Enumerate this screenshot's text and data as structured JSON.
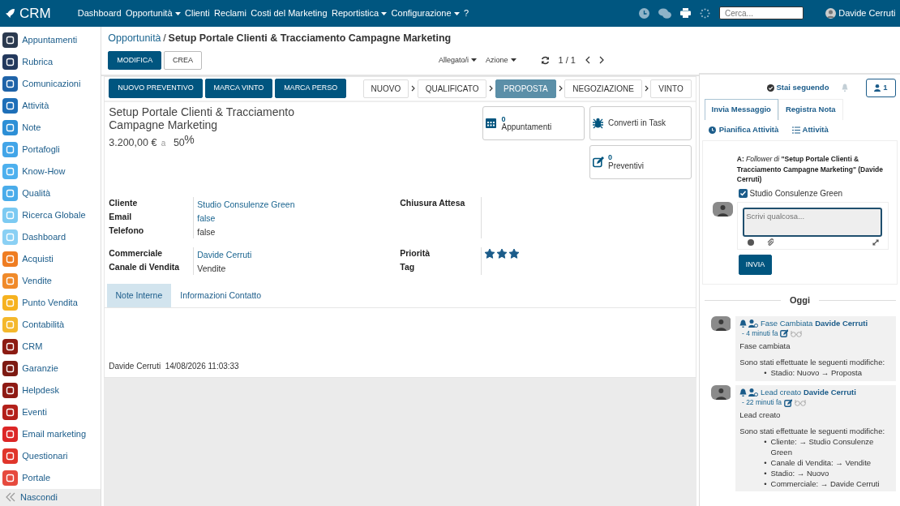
{
  "navbar": {
    "brand": "CRM",
    "menu": [
      {
        "label": "Dashboard",
        "dropdown": false
      },
      {
        "label": "Opportunità",
        "dropdown": true
      },
      {
        "label": "Clienti",
        "dropdown": false
      },
      {
        "label": "Reclami",
        "dropdown": false
      },
      {
        "label": "Costi del Marketing",
        "dropdown": false
      },
      {
        "label": "Reportistica",
        "dropdown": true
      },
      {
        "label": "Configurazione",
        "dropdown": true
      },
      {
        "label": "?",
        "dropdown": false
      }
    ],
    "search": {
      "placeholder": "Cerca..."
    },
    "user": "Davide Cerruti"
  },
  "sidebar": {
    "items": [
      {
        "label": "Appuntamenti",
        "color": "#2b3a4f"
      },
      {
        "label": "Rubrica",
        "color": "#23395d"
      },
      {
        "label": "Comunicazioni",
        "color": "#1f63a8"
      },
      {
        "label": "Attività",
        "color": "#1e6fb8"
      },
      {
        "label": "Note",
        "color": "#2d8fd6"
      },
      {
        "label": "Portafogli",
        "color": "#42a5e8"
      },
      {
        "label": "Know-How",
        "color": "#4db0ee"
      },
      {
        "label": "Qualità",
        "color": "#4aacea"
      },
      {
        "label": "Ricerca Globale",
        "color": "#7ccaf2"
      },
      {
        "label": "Dashboard",
        "color": "#8ad0f4"
      },
      {
        "label": "Acquisti",
        "color": "#ef7d22"
      },
      {
        "label": "Vendite",
        "color": "#f08a2a"
      },
      {
        "label": "Punto Vendita",
        "color": "#f6b21f"
      },
      {
        "label": "Contabilità",
        "color": "#f4b82c"
      },
      {
        "label": "CRM",
        "color": "#8c1c13"
      },
      {
        "label": "Garanzie",
        "color": "#7d1a12"
      },
      {
        "label": "Helpdesk",
        "color": "#8e1a14"
      },
      {
        "label": "Eventi",
        "color": "#b3201b"
      },
      {
        "label": "Email marketing",
        "color": "#dc2626"
      },
      {
        "label": "Questionari",
        "color": "#e0352b"
      },
      {
        "label": "Portale",
        "color": "#e64a3e"
      }
    ],
    "hide": "Nascondi"
  },
  "breadcrumb": {
    "parent": "Opportunità",
    "separator": "/",
    "current": "Setup Portale Clienti & Tracciamento Campagne Marketing"
  },
  "toolbar": {
    "edit": "MODIFICA",
    "create": "CREA",
    "dropdowns": [
      "Allegato/i",
      "Azione"
    ],
    "pager": "1 / 1"
  },
  "actions": [
    "NUOVO PREVENTIVO",
    "MARCA VINTO",
    "MARCA PERSO"
  ],
  "stages": [
    {
      "label": "NUOVO",
      "selected": false
    },
    {
      "label": "QUALIFICATO",
      "selected": false
    },
    {
      "label": "PROPOSTA",
      "selected": true
    },
    {
      "label": "NEGOZIAZIONE",
      "selected": false
    },
    {
      "label": "VINTO",
      "selected": false
    }
  ],
  "record": {
    "title": "Setup Portale Clienti & Tracciamento Campagne Marketing",
    "amount": "3.200,00 €",
    "at": "a",
    "probability": "50",
    "percent": "%"
  },
  "smart_buttons": [
    {
      "kind": "calendar",
      "count": "0",
      "label": "Appuntamenti"
    },
    {
      "kind": "bug",
      "label": "Converti in Task"
    },
    {
      "kind": "edit",
      "count": "0",
      "label": "Preventivi"
    }
  ],
  "field_groups": [
    {
      "left": [
        {
          "label": "Cliente",
          "value": "Studio Consulenze Green",
          "kind": "link"
        },
        {
          "label": "Email",
          "value": "false",
          "kind": "link"
        },
        {
          "label": "Telefono",
          "value": "false",
          "kind": "text"
        }
      ],
      "right": [
        {
          "label": "Chiusura Attesa",
          "kind": "text"
        }
      ]
    },
    {
      "left": [
        {
          "label": "Commerciale",
          "value": "Davide Cerruti",
          "kind": "link"
        },
        {
          "label": "Canale di Vendita",
          "value": "Vendite",
          "kind": "text"
        }
      ],
      "right": [
        {
          "label": "Priorità",
          "kind": "stars",
          "stars": 3
        },
        {
          "label": "Tag",
          "kind": "text"
        }
      ]
    }
  ],
  "notebook_tabs": [
    {
      "label": "Note Interne",
      "selected": true
    },
    {
      "label": "Informazioni Contatto",
      "selected": false
    }
  ],
  "footer": {
    "author": "Davide Cerruti",
    "date": "14/08/2026 11:03:33"
  },
  "chatter": {
    "following": "Stai seguendo",
    "followers": "1",
    "tabs": [
      {
        "label": "Invia Messaggio",
        "selected": true
      },
      {
        "label": "Registra Nota",
        "selected": false
      }
    ],
    "links": [
      {
        "kind": "clock",
        "label": "Pianifica Attività"
      },
      {
        "kind": "list",
        "label": "Attività"
      }
    ],
    "recipients": "**A:** *Follower di* **\"Setup Portale Clienti & Tracciamento Campagne Marketing\" (Davide Cerruti)**",
    "recipient_option": {
      "label": "Studio Consulenze Green",
      "checked": true
    },
    "placeholder": "Scrivi qualcosa...",
    "send": "INVIA",
    "day": "Oggi",
    "messages": [
      {
        "subject": "Fase Cambiata",
        "author": "Davide Cerruti",
        "time": "- 4 minuti fa",
        "bullet": "•",
        "body": "Fase cambiata",
        "intro": "Sono stati effettuate le seguenti modifiche:",
        "changes": [
          "Stadio: Nuovo → Proposta"
        ]
      },
      {
        "subject": "Lead creato",
        "author": "Davide Cerruti",
        "time": "- 22 minuti fa",
        "bullet": "•",
        "body": "Lead creato",
        "intro": "Sono stati effettuate le seguenti modifiche:",
        "changes": [
          "Cliente: → Studio Consulenze Green",
          "Canale di Vendita: → Vendite",
          "Stadio: → Nuovo",
          "Commerciale: → Davide Cerruti"
        ]
      }
    ]
  }
}
